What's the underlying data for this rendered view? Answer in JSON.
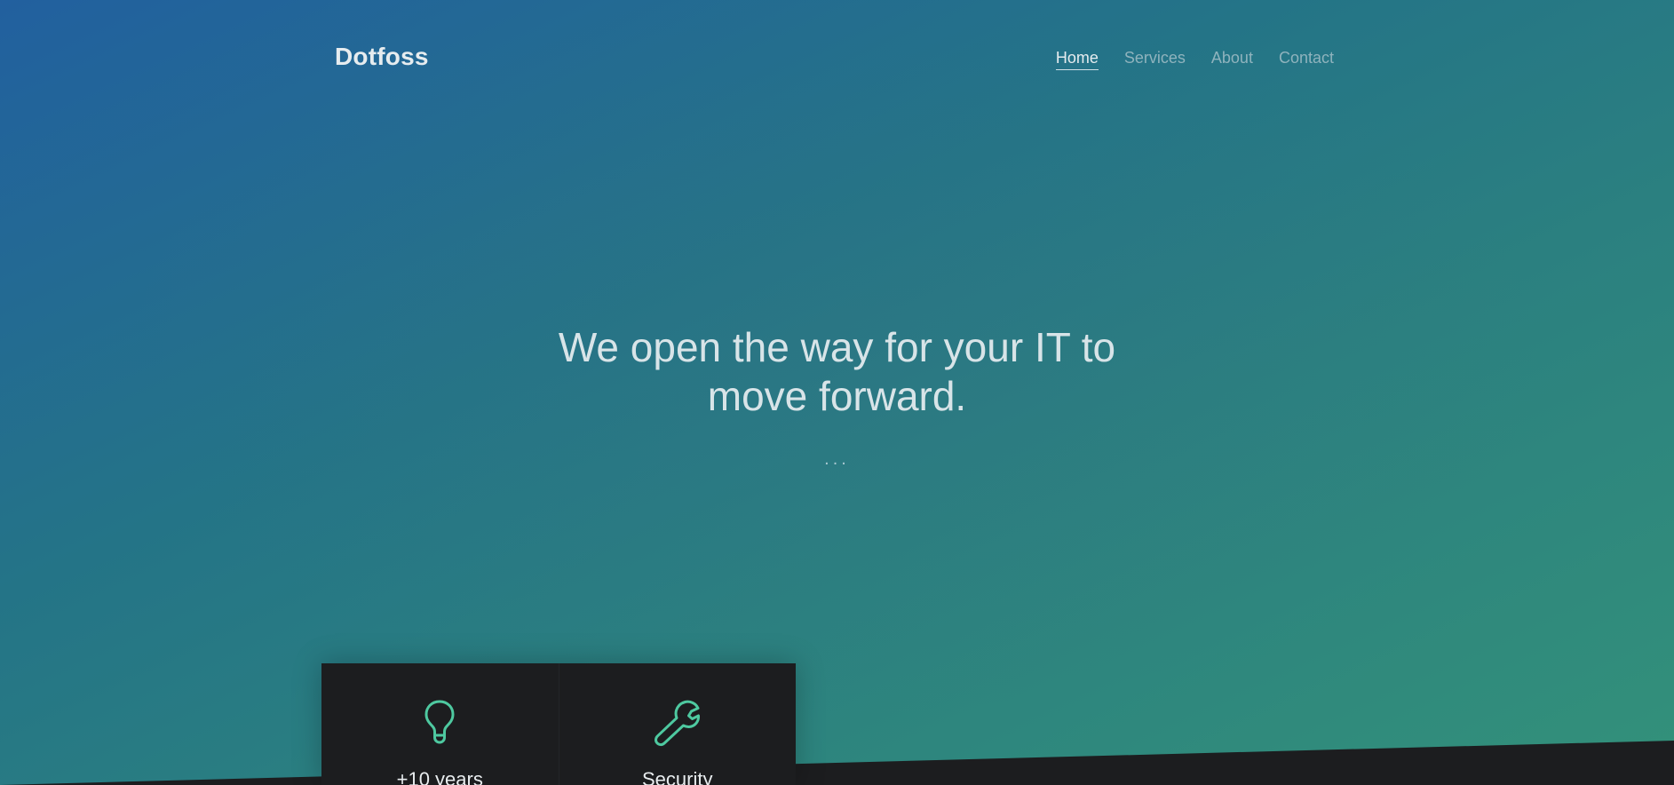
{
  "site": {
    "logo": "Dotfoss"
  },
  "nav": {
    "items": [
      {
        "label": "Home",
        "active": true
      },
      {
        "label": "Services",
        "active": false
      },
      {
        "label": "About",
        "active": false
      },
      {
        "label": "Contact",
        "active": false
      }
    ]
  },
  "hero": {
    "headline_line1": "We open the way for your IT to",
    "headline_line2": "move forward.",
    "dots": "..."
  },
  "features": [
    {
      "icon": "lightbulb-icon",
      "title": "+10 years"
    },
    {
      "icon": "wrench-icon",
      "title": "Security"
    }
  ],
  "colors": {
    "accent": "#4ec9a0",
    "dark_panel": "#1c1d1f",
    "gradient_start": "#22609f",
    "gradient_end": "#33917a"
  }
}
